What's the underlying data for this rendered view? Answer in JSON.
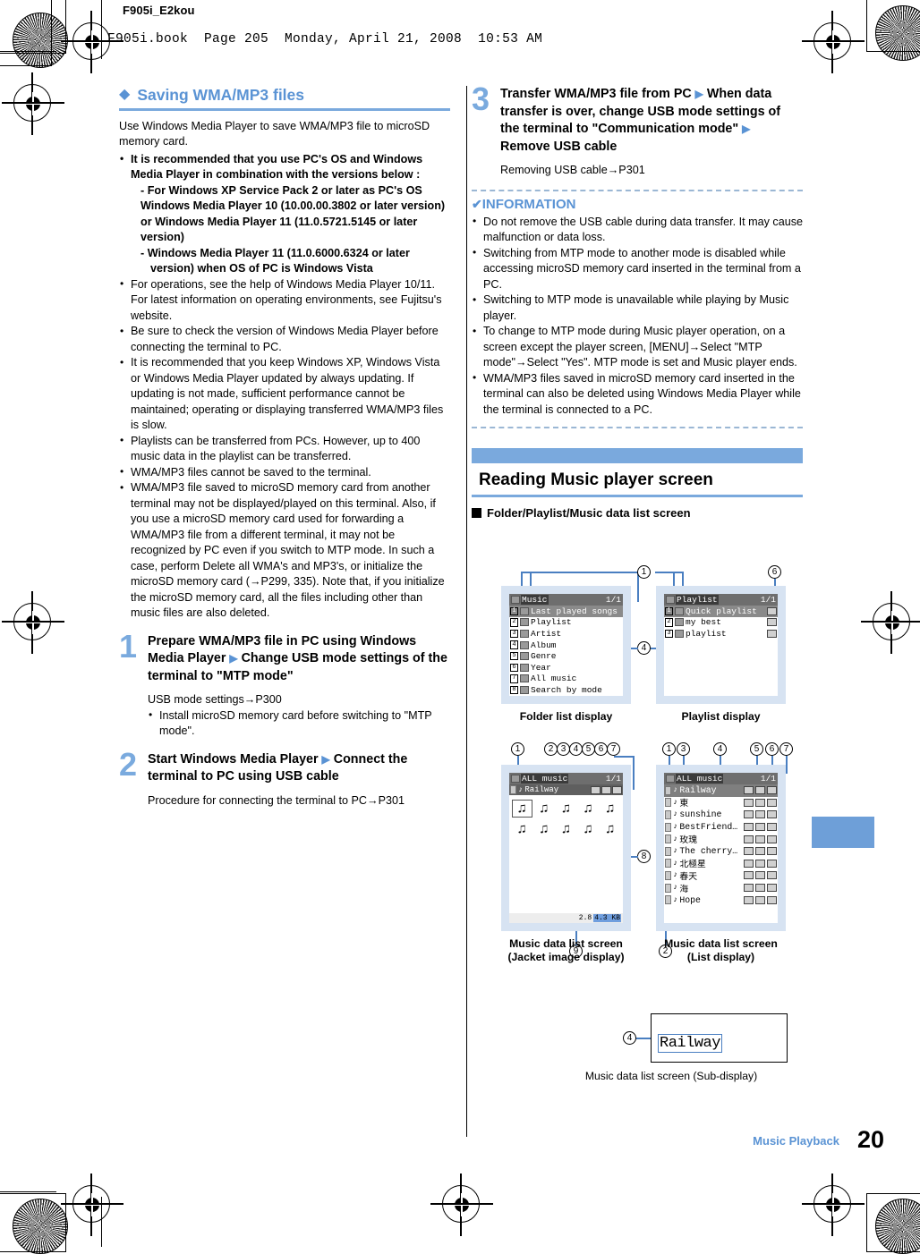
{
  "header": {
    "doc_id": "F905i_E2kou",
    "book_line": "F905i.book  Page 205  Monday, April 21, 2008  10:53 AM"
  },
  "footer": {
    "section": "Music Playback",
    "page_number": "20"
  },
  "left_column": {
    "section_heading": "Saving WMA/MP3 files",
    "intro": "Use Windows Media Player to save WMA/MP3 file to microSD memory card.",
    "bullets": [
      {
        "bold": true,
        "text": "It is recommended that you use PC's OS and Windows Media Player in combination with the versions below :",
        "sub": [
          "- For Windows XP Service Pack 2 or later as PC's OS",
          "Windows Media Player 10 (10.00.00.3802 or later version)",
          "or Windows Media Player 11 (11.0.5721.5145 or later version)",
          "- Windows Media Player 11 (11.0.6000.6324 or later version) when OS of PC is Windows Vista"
        ]
      },
      {
        "bold": false,
        "text": "For operations, see the help of Windows Media Player 10/11. For latest information on operating environments, see Fujitsu's website."
      },
      {
        "bold": false,
        "text": "Be sure to check the version of Windows Media Player before connecting the terminal to PC."
      },
      {
        "bold": false,
        "text": "It is recommended that you keep Windows XP, Windows Vista or Windows Media Player updated by always updating. If updating is not made, sufficient performance cannot be maintained; operating or displaying transferred WMA/MP3 files is slow."
      },
      {
        "bold": false,
        "text": "Playlists can be transferred from PCs. However, up to 400 music data in the playlist can be transferred."
      },
      {
        "bold": false,
        "text": "WMA/MP3 files cannot be saved to the terminal."
      },
      {
        "bold": false,
        "text": "WMA/MP3 file saved to microSD memory card from another terminal may not be displayed/played on this terminal. Also, if you use a microSD memory card used for forwarding a WMA/MP3 file from a different terminal, it may not be recognized by PC even if you switch to MTP mode. In such a case, perform Delete all WMA's and MP3's, or initialize the microSD memory card (→P299, 335). Note that, if you initialize the microSD memory card, all the files including other than music files are also deleted."
      }
    ],
    "steps": [
      {
        "num": "1",
        "title_part1": "Prepare WMA/MP3 file in PC using Windows Media Player ",
        "title_part2": " Change USB mode settings of the terminal to \"MTP mode\"",
        "sub": "USB mode settings→P300",
        "sub_bullet": "Install microSD memory card before switching to \"MTP mode\"."
      },
      {
        "num": "2",
        "title_part1": "Start Windows Media Player ",
        "title_part2": " Connect the terminal to PC using USB cable",
        "sub": "Procedure for connecting the terminal to PC→P301",
        "sub_bullet": ""
      }
    ]
  },
  "right_column": {
    "step3": {
      "num": "3",
      "title_part1": "Transfer WMA/MP3 file from PC ",
      "title_part2": " When data transfer is over, change USB mode settings of the terminal to \"Communication mode\" ",
      "title_part3": " Remove USB cable",
      "sub": "Removing USB cable→P301"
    },
    "information": {
      "title": "INFORMATION",
      "items": [
        "Do not remove the USB cable during data transfer. It may cause malfunction or data loss.",
        "Switching from MTP mode to another mode is disabled while accessing microSD memory card inserted in the terminal from a PC.",
        "Switching to MTP mode is unavailable while playing by Music player.",
        "To change to MTP mode during Music player operation, on a screen except the player screen, [MENU]→Select \"MTP mode\"→Select \"Yes\". MTP mode is set and Music player ends.",
        "WMA/MP3 files saved in microSD memory card inserted in the terminal can also be deleted using Windows Media Player while the terminal is connected to a PC."
      ]
    },
    "band_title": "Reading Music player screen",
    "sub_head": "Folder/Playlist/Music data list screen",
    "screens": {
      "folder_list": {
        "caption": "Folder list display",
        "title": "Music",
        "page": "1/1",
        "rows": [
          {
            "num": "1",
            "label": "Last played songs",
            "selected": true
          },
          {
            "num": "2",
            "label": "Playlist",
            "selected": false
          },
          {
            "num": "3",
            "label": "Artist",
            "selected": false
          },
          {
            "num": "4",
            "label": "Album",
            "selected": false
          },
          {
            "num": "5",
            "label": "Genre",
            "selected": false
          },
          {
            "num": "6",
            "label": "Year",
            "selected": false
          },
          {
            "num": "7",
            "label": "All music",
            "selected": false
          },
          {
            "num": "8",
            "label": "Search by  mode",
            "selected": false
          }
        ]
      },
      "playlist": {
        "caption": "Playlist display",
        "title": "Playlist",
        "page": "1/1",
        "rows": [
          {
            "num": "1",
            "label": "Quick playlist",
            "selected": true
          },
          {
            "num": "2",
            "label": "my best",
            "selected": false
          },
          {
            "num": "3",
            "label": "playlist",
            "selected": false
          }
        ]
      },
      "jacket": {
        "caption_line1": "Music data list screen",
        "caption_line2": "(Jacket image display)",
        "title": "ALL music",
        "page": "1/1",
        "now_playing": "Railway",
        "notes_count": 10,
        "size_left": "2.8",
        "size_right": "4.3 KB"
      },
      "list": {
        "caption_line1": "Music data list screen",
        "caption_line2": "(List display)",
        "title": "ALL music",
        "page": "1/1",
        "tracks": [
          {
            "name": "Railway",
            "selected": true
          },
          {
            "name": "東",
            "selected": false
          },
          {
            "name": "sunshine",
            "selected": false
          },
          {
            "name": "BestFriend…",
            "selected": false
          },
          {
            "name": "玫瑰",
            "selected": false
          },
          {
            "name": "The cherry…",
            "selected": false
          },
          {
            "name": "北極星",
            "selected": false
          },
          {
            "name": "春天",
            "selected": false
          },
          {
            "name": "海",
            "selected": false
          },
          {
            "name": "Hope",
            "selected": false
          }
        ]
      },
      "sub_display": {
        "caption": "Music data list screen (Sub-display)",
        "text": "Railway",
        "callout": "4"
      }
    },
    "callouts": {
      "top_group": [
        "1",
        "6",
        "4"
      ],
      "jacket_group": [
        "1",
        "2",
        "3",
        "4",
        "5",
        "6",
        "7",
        "8",
        "9"
      ],
      "list_group": [
        "1",
        "3",
        "4",
        "5",
        "6",
        "7",
        "2"
      ]
    }
  },
  "colors": {
    "accent_blue": "#5a93d4",
    "band_blue": "#7aa9dd",
    "screen_bg": "#d7e3f2",
    "lead_blue": "#4a7fc1"
  }
}
